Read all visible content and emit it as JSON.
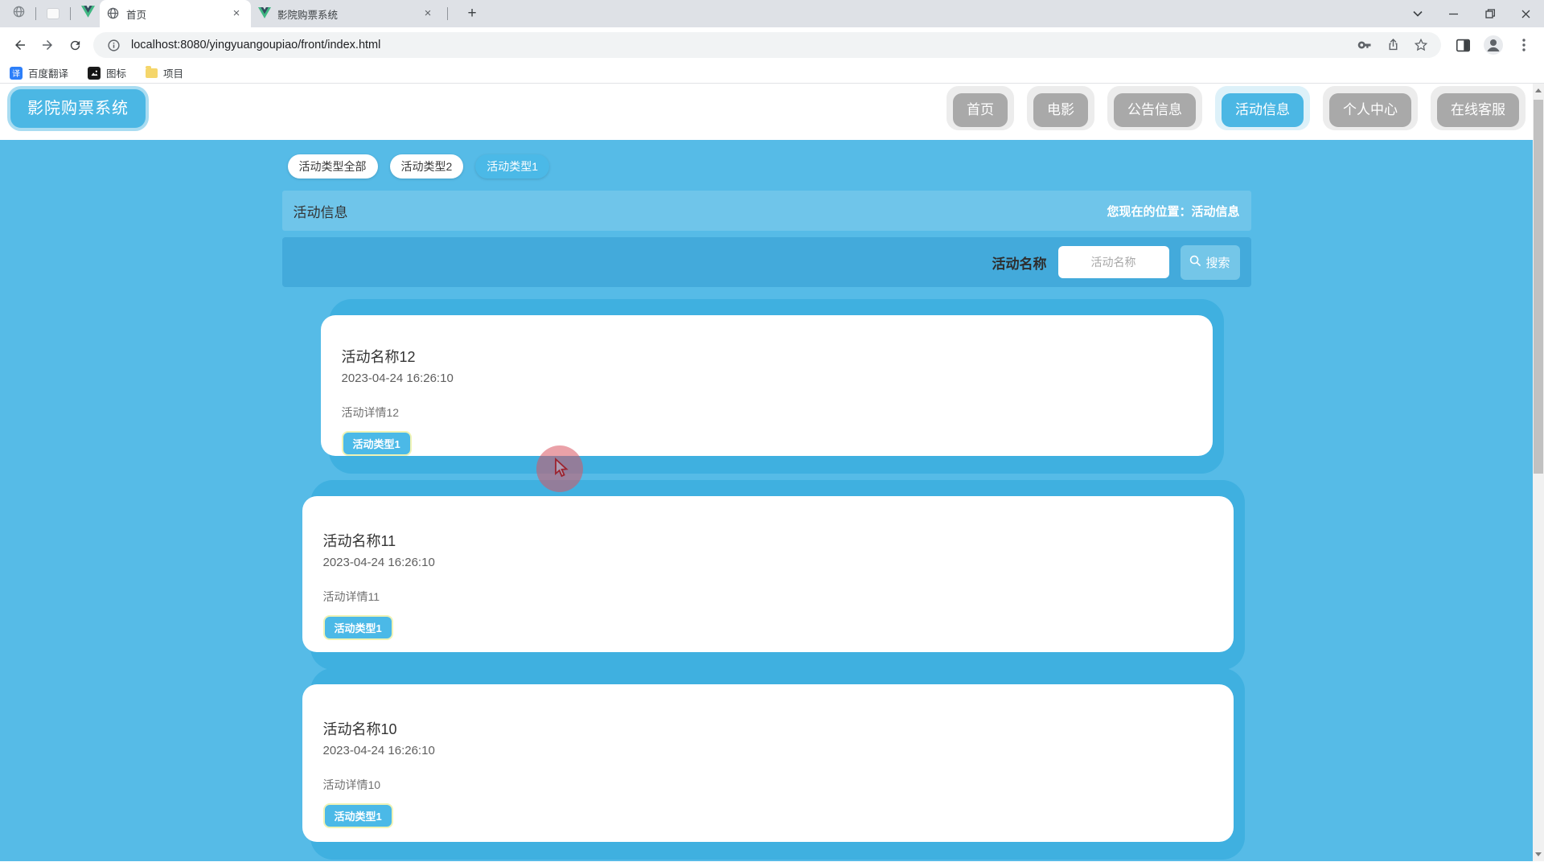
{
  "browser": {
    "pinned_tabs": [
      {
        "icon": "globe-icon"
      },
      {
        "icon": "extension-icon"
      },
      {
        "icon": "vue-icon"
      }
    ],
    "tabs": [
      {
        "label": "首页",
        "icon": "globe-icon",
        "active": true
      },
      {
        "label": "影院购票系统",
        "icon": "vue-icon",
        "active": false
      }
    ],
    "url": "localhost:8080/yingyuangoupiao/front/index.html",
    "bookmarks": [
      {
        "label": "百度翻译",
        "icon": "translate-icon",
        "glyph": "译"
      },
      {
        "label": "图标",
        "icon": "image-icon"
      },
      {
        "label": "项目",
        "icon": "folder-icon"
      }
    ]
  },
  "header": {
    "logo": "影院购票系统",
    "nav": [
      {
        "label": "首页",
        "active": false
      },
      {
        "label": "电影",
        "active": false
      },
      {
        "label": "公告信息",
        "active": false
      },
      {
        "label": "活动信息",
        "active": true
      },
      {
        "label": "个人中心",
        "active": false
      },
      {
        "label": "在线客服",
        "active": false
      }
    ]
  },
  "filters": {
    "chips": [
      {
        "label": "活动类型全部",
        "active": false
      },
      {
        "label": "活动类型2",
        "active": false
      },
      {
        "label": "活动类型1",
        "active": true
      }
    ]
  },
  "section": {
    "title": "活动信息",
    "breadcrumb": "您现在的位置：活动信息"
  },
  "search": {
    "label": "活动名称",
    "placeholder": "活动名称",
    "button": "搜索"
  },
  "cards": [
    {
      "title": "活动名称12",
      "datetime": "2023-04-24 16:26:10",
      "detail": "活动详情12",
      "tag": "活动类型1"
    },
    {
      "title": "活动名称11",
      "datetime": "2023-04-24 16:26:10",
      "detail": "活动详情11",
      "tag": "活动类型1"
    },
    {
      "title": "活动名称10",
      "datetime": "2023-04-24 16:26:10",
      "detail": "活动详情10",
      "tag": "活动类型1"
    }
  ],
  "colors": {
    "accent": "#4bb7e4",
    "page_bg": "#56bbe7",
    "card_backing": "#3fb0e0",
    "search_band": "#43aadb",
    "tag_border": "#eff3b6"
  }
}
